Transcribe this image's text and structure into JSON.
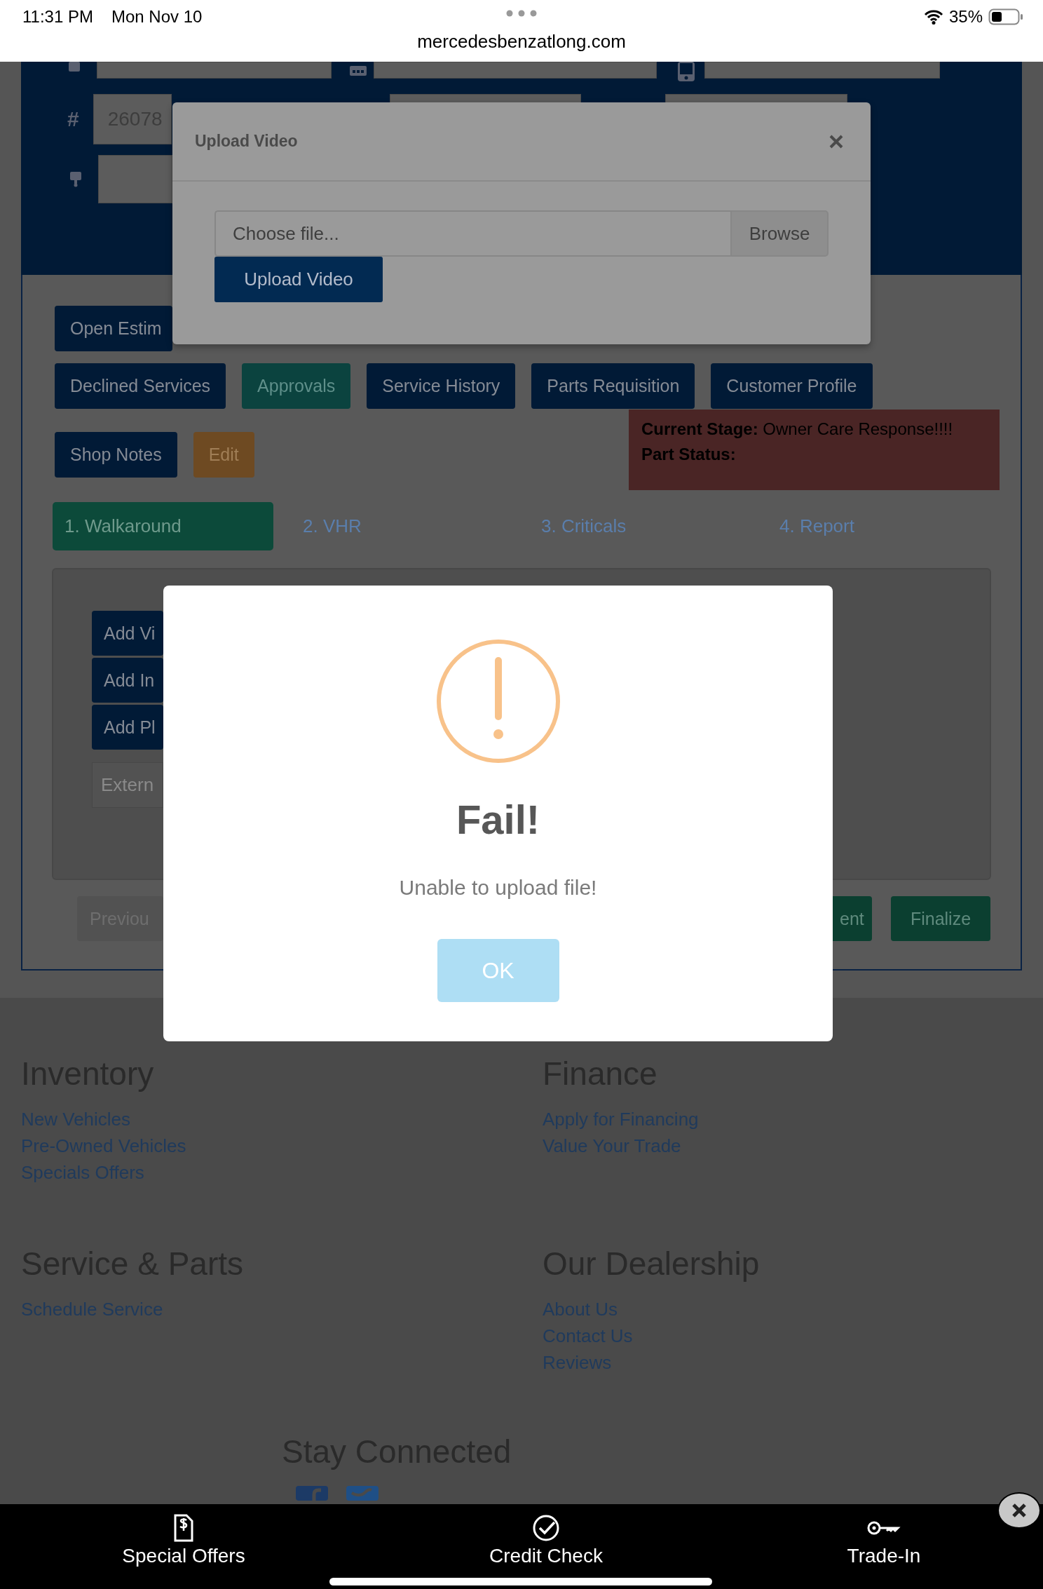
{
  "status_bar": {
    "time": "11:31 PM",
    "date": "Mon Nov 10",
    "url": "mercedesbenzatlong.com",
    "battery": "35%"
  },
  "customer_fields": {
    "number_symbol": "#",
    "number_value": "26078"
  },
  "action_rows": [
    [
      {
        "label": "Open Estim",
        "kind": "primary"
      }
    ],
    [
      {
        "label": "Declined Services",
        "kind": "primary"
      },
      {
        "label": "Approvals",
        "kind": "teal"
      },
      {
        "label": "Service History",
        "kind": "primary"
      },
      {
        "label": "Parts Requisition",
        "kind": "primary"
      },
      {
        "label": "Customer Profile",
        "kind": "primary"
      }
    ],
    [
      {
        "label": "Shop Notes",
        "kind": "primary"
      },
      {
        "label": "Edit",
        "kind": "warning"
      }
    ]
  ],
  "stage_box": {
    "stage_label": "Current Stage:",
    "stage_value": "Owner Care Response!!!!",
    "part_label": "Part Status:"
  },
  "steps": [
    {
      "label": "1. Walkaround",
      "selected": true
    },
    {
      "label": "2. VHR",
      "selected": false
    },
    {
      "label": "3. Criticals",
      "selected": false
    },
    {
      "label": "4. Report",
      "selected": false
    }
  ],
  "walkaround": {
    "buttons": [
      "Add Vi",
      "Add In",
      "Add Pl"
    ],
    "placeholder": "Extern"
  },
  "nav_buttons": [
    {
      "label": "Previou",
      "kind": "secondary"
    },
    {
      "label": "ent",
      "kind": "success"
    },
    {
      "label": "Finalize",
      "kind": "success"
    }
  ],
  "footer": {
    "sections": [
      {
        "heading": "Inventory",
        "links": [
          "New Vehicles",
          "Pre-Owned Vehicles",
          "Specials Offers"
        ]
      },
      {
        "heading": "Finance",
        "links": [
          "Apply for Financing",
          "Value Your Trade"
        ]
      },
      {
        "heading": "Service & Parts",
        "links": [
          "Schedule Service"
        ]
      },
      {
        "heading": "Our Dealership",
        "links": [
          "About Us",
          "Contact Us",
          "Reviews"
        ]
      }
    ],
    "social_heading": "Stay Connected"
  },
  "upload_modal": {
    "title": "Upload Video",
    "placeholder": "Choose file...",
    "browse": "Browse",
    "upload_button": "Upload Video"
  },
  "alert": {
    "title": "Fail!",
    "message": "Unable to upload file!",
    "button": "OK"
  },
  "bottom_bar": [
    {
      "label": "Special Offers",
      "kind": "offers"
    },
    {
      "label": "Credit Check",
      "kind": "check"
    },
    {
      "label": "Trade-In",
      "kind": "key"
    }
  ]
}
